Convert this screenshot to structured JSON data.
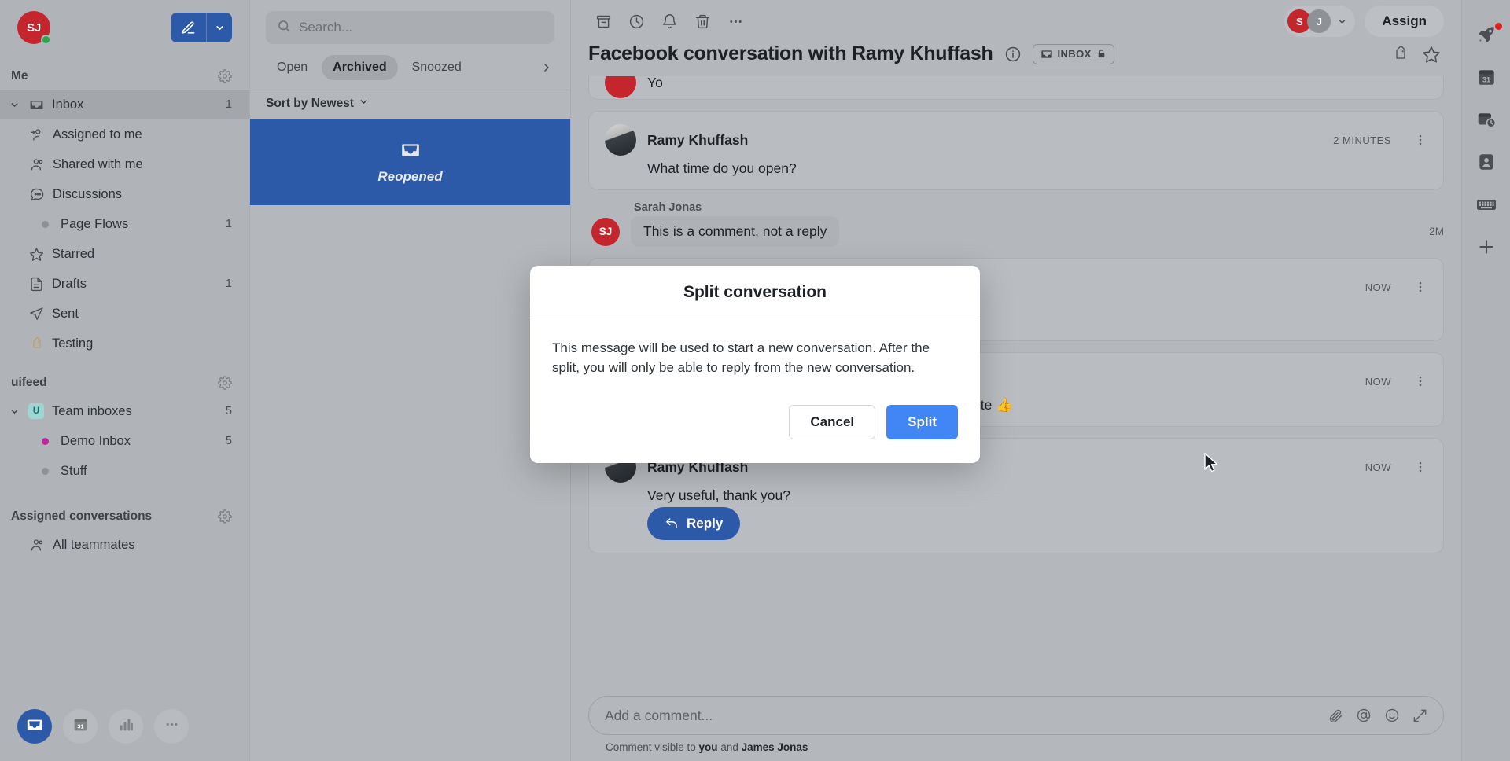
{
  "sidebar": {
    "user": {
      "initials": "SJ",
      "status_color": "#28a745"
    },
    "compose": {
      "icon": "pencil-icon",
      "caret": "chevron-down-icon"
    },
    "sections": [
      {
        "title": "Me",
        "items": [
          {
            "label": "Inbox",
            "count": "1",
            "icon": "inbox-icon",
            "active": true,
            "expandable": true
          },
          {
            "label": "Assigned to me",
            "count": "",
            "icon": "assigned-person-icon",
            "indent": 1
          },
          {
            "label": "Shared with me",
            "count": "",
            "icon": "people-icon",
            "indent": 1
          },
          {
            "label": "Discussions",
            "count": "",
            "icon": "chat-bubble-icon",
            "indent": 1
          },
          {
            "label": "Page Flows",
            "count": "1",
            "icon": "dot-gray",
            "indent": 1
          },
          {
            "label": "Starred",
            "count": "",
            "icon": "star-icon"
          },
          {
            "label": "Drafts",
            "count": "1",
            "icon": "document-icon"
          },
          {
            "label": "Sent",
            "count": "",
            "icon": "paper-plane-icon"
          },
          {
            "label": "Testing",
            "count": "",
            "icon": "tag-icon"
          }
        ]
      },
      {
        "title": "uifeed",
        "items": [
          {
            "label": "Team inboxes",
            "count": "5",
            "icon": "team-badge-u",
            "expandable": true
          },
          {
            "label": "Demo Inbox",
            "count": "5",
            "icon": "dot-magenta",
            "indent": 1
          },
          {
            "label": "Stuff",
            "count": "",
            "icon": "dot-gray",
            "indent": 1
          }
        ]
      },
      {
        "title": "Assigned conversations",
        "items": [
          {
            "label": "All teammates",
            "count": "",
            "icon": "people-icon",
            "indent": 1
          }
        ]
      }
    ],
    "dock": [
      {
        "name": "inbox-icon",
        "active": true
      },
      {
        "name": "calendar-31-icon",
        "active": false
      },
      {
        "name": "bar-chart-icon",
        "active": false
      },
      {
        "name": "more-horizontal-icon",
        "active": false
      }
    ]
  },
  "list_panel": {
    "search": {
      "placeholder": "Search...",
      "icon": "search-icon"
    },
    "tabs": [
      {
        "label": "Open",
        "selected": false
      },
      {
        "label": "Archived",
        "selected": true
      },
      {
        "label": "Snoozed",
        "selected": false
      }
    ],
    "tabs_overflow_icon": "chevron-right-icon",
    "sort": {
      "label": "Sort by Newest",
      "icon": "chevron-down-icon"
    },
    "conversations": [
      {
        "status": "Reopened",
        "icon": "inbox-icon",
        "selected": true
      }
    ]
  },
  "conversation": {
    "toolbar": [
      {
        "name": "archive-icon"
      },
      {
        "name": "snooze-clock-icon"
      },
      {
        "name": "bell-icon"
      },
      {
        "name": "trash-icon"
      },
      {
        "name": "more-horizontal-icon"
      }
    ],
    "assignees": [
      {
        "initials": "S",
        "color": "#c5252c"
      },
      {
        "initials": "J",
        "color": "#8e9196"
      }
    ],
    "assign_button": "Assign",
    "title": "Facebook conversation with Ramy Khuffash",
    "info_icon": "info-icon",
    "inbox_badge": {
      "label": "INBOX",
      "icon": "inbox-icon",
      "lock_icon": "lock-icon"
    },
    "title_actions": [
      {
        "name": "tag-icon"
      },
      {
        "name": "star-icon"
      }
    ],
    "messages": [
      {
        "type": "message",
        "clipped": true,
        "author": "",
        "time": "",
        "text": "Yo",
        "avatar_kind": "red"
      },
      {
        "type": "message",
        "author": "Ramy Khuffash",
        "time": "2 MINUTES",
        "text": "What time do you open?",
        "avatar_kind": "photo"
      },
      {
        "type": "comment",
        "author": "Sarah Jonas",
        "initials": "SJ",
        "time": "2M",
        "text": "This is a comment, not a reply"
      },
      {
        "type": "message",
        "author": "",
        "time": "NOW",
        "text": "",
        "avatar_kind": "hidden"
      },
      {
        "type": "message",
        "author": "",
        "time": "NOW",
        "text": "We open at all times because we are an internet website 👍",
        "avatar_kind": "red"
      },
      {
        "type": "message",
        "author": "Ramy Khuffash",
        "time": "NOW",
        "text": "Very useful, thank you?",
        "avatar_kind": "photo",
        "reply_button": "Reply"
      }
    ],
    "composer": {
      "placeholder": "Add a comment...",
      "icons": [
        {
          "name": "attachment-icon"
        },
        {
          "name": "mention-icon"
        },
        {
          "name": "emoji-icon"
        },
        {
          "name": "expand-icon"
        }
      ],
      "note_prefix": "Comment visible to ",
      "note_you": "you",
      "note_mid": " and ",
      "note_person": "James Jonas"
    }
  },
  "right_rail": [
    {
      "name": "rocket-icon",
      "badge": true
    },
    {
      "name": "calendar-31-icon",
      "badge": false
    },
    {
      "name": "history-card-icon",
      "badge": false
    },
    {
      "name": "contact-card-icon",
      "badge": false
    },
    {
      "name": "keyboard-icon",
      "badge": false
    },
    {
      "name": "plus-icon",
      "badge": false
    }
  ],
  "modal": {
    "title": "Split conversation",
    "body": "This message will be used to start a new conversation. After the split, you will only be able to reply from the new conversation.",
    "cancel_label": "Cancel",
    "confirm_label": "Split",
    "confirm_color": "#4285f4"
  }
}
